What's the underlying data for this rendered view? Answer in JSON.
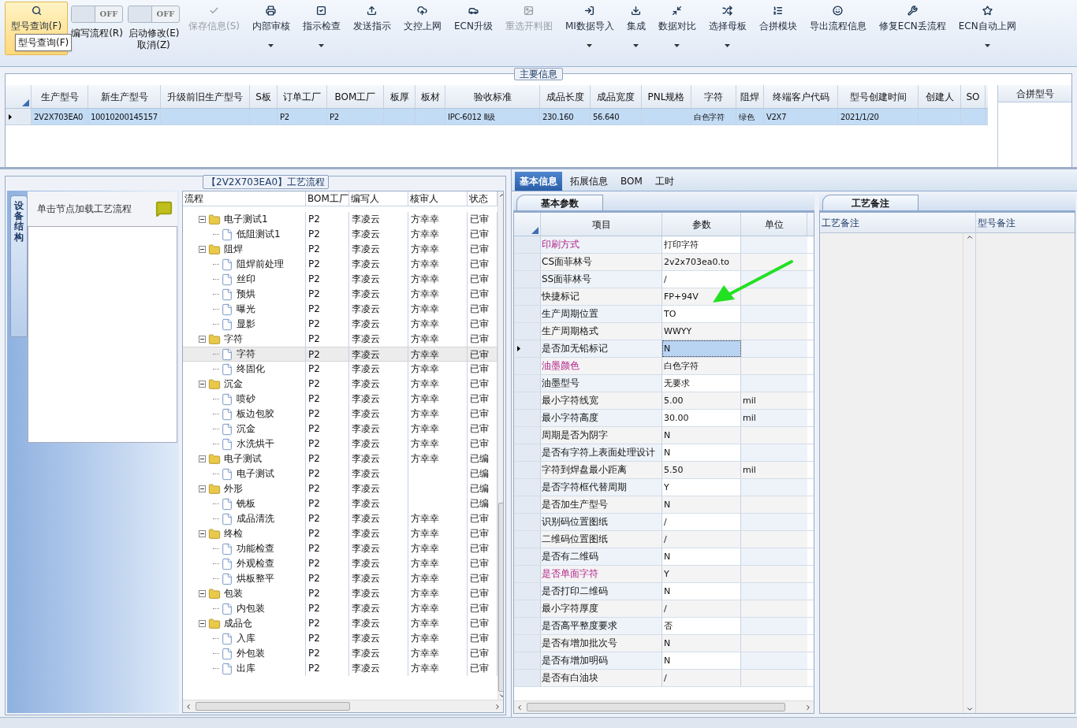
{
  "toolbar": {
    "items": [
      {
        "kind": "button",
        "label": "型号查询(F)",
        "active": true,
        "disabled": false,
        "dropdown": false
      },
      {
        "kind": "toggle",
        "switch": "OFF",
        "label": "编写流程(R)"
      },
      {
        "kind": "toggle",
        "switch": "OFF",
        "label": "启动修改(E)",
        "sublabel": "取消(Z)"
      },
      {
        "kind": "button",
        "label": "保存信息(S)",
        "active": false,
        "disabled": true,
        "dropdown": false
      },
      {
        "kind": "button",
        "label": "内部审核",
        "active": false,
        "disabled": false,
        "dropdown": true
      },
      {
        "kind": "button",
        "label": "指示检查",
        "active": false,
        "disabled": false,
        "dropdown": true
      },
      {
        "kind": "button",
        "label": "发送指示",
        "active": false,
        "disabled": false,
        "dropdown": false
      },
      {
        "kind": "button",
        "label": "文控上网",
        "active": false,
        "disabled": false,
        "dropdown": false
      },
      {
        "kind": "button",
        "label": "ECN升级",
        "active": false,
        "disabled": false,
        "dropdown": false
      },
      {
        "kind": "button",
        "label": "重选开料图",
        "active": false,
        "disabled": true,
        "dropdown": false
      },
      {
        "kind": "button",
        "label": "MI数据导入",
        "active": false,
        "disabled": false,
        "dropdown": true
      },
      {
        "kind": "button",
        "label": "集成",
        "active": false,
        "disabled": false,
        "dropdown": true
      },
      {
        "kind": "button",
        "label": "数据对比",
        "active": false,
        "disabled": false,
        "dropdown": true
      },
      {
        "kind": "button",
        "label": "选择母板",
        "active": false,
        "disabled": false,
        "dropdown": true
      },
      {
        "kind": "button",
        "label": "合拼模块",
        "active": false,
        "disabled": false,
        "dropdown": false
      },
      {
        "kind": "button",
        "label": "导出流程信息",
        "active": false,
        "disabled": false,
        "dropdown": false
      },
      {
        "kind": "button",
        "label": "修复ECN丢流程",
        "active": false,
        "disabled": false,
        "dropdown": false
      },
      {
        "kind": "button",
        "label": "ECN自动上网",
        "active": false,
        "disabled": false,
        "dropdown": true
      }
    ],
    "tooltip": "型号查询(F)"
  },
  "main_info": {
    "title": "主要信息",
    "columns": [
      "生产型号",
      "新生产型号",
      "升级前旧生产型号",
      "S板",
      "订单工厂",
      "BOM工厂",
      "板厚",
      "板材",
      "验收标准",
      "成品长度",
      "成品宽度",
      "PNL规格",
      "字符",
      "阻焊",
      "终端客户代码",
      "型号创建时间",
      "创建人",
      "SO"
    ],
    "rows": [
      {
        "selected": true,
        "cells": [
          "2V2X703EA0",
          "10010200145157",
          null,
          null,
          "P2",
          "P2",
          null,
          null,
          "IPC-6012 Ⅱ级",
          "230.160",
          "56.640",
          null,
          "白色字符",
          "绿色",
          "V2X7",
          "2021/1/20",
          null,
          null
        ]
      }
    ],
    "side_column": "合拼型号"
  },
  "side_tab": "设备结构",
  "node_hint": "单击节点加载工艺流程",
  "process": {
    "title": "【2V2X703EA0】工艺流程",
    "columns": [
      "流程",
      "BOM工厂",
      "编写人",
      "核审人",
      "状态"
    ],
    "rows": [
      {
        "name": "电子测试1",
        "bom": "P2",
        "writer": "李凌云",
        "reviewer": "方幸幸",
        "status": "已审",
        "selected": false,
        "expanded": true,
        "children": [
          {
            "name": "低阻测试1",
            "bom": "P2",
            "writer": "李凌云",
            "reviewer": "方幸幸",
            "status": "已审",
            "selected": false
          }
        ]
      },
      {
        "name": "阻焊",
        "bom": "P2",
        "writer": "李凌云",
        "reviewer": "方幸幸",
        "status": "已审",
        "selected": false,
        "expanded": true,
        "children": [
          {
            "name": "阻焊前处理",
            "bom": "P2",
            "writer": "李凌云",
            "reviewer": "方幸幸",
            "status": "已审",
            "selected": false
          },
          {
            "name": "丝印",
            "bom": "P2",
            "writer": "李凌云",
            "reviewer": "方幸幸",
            "status": "已审",
            "selected": false
          },
          {
            "name": "预烘",
            "bom": "P2",
            "writer": "李凌云",
            "reviewer": "方幸幸",
            "status": "已审",
            "selected": false
          },
          {
            "name": "曝光",
            "bom": "P2",
            "writer": "李凌云",
            "reviewer": "方幸幸",
            "status": "已审",
            "selected": false
          },
          {
            "name": "显影",
            "bom": "P2",
            "writer": "李凌云",
            "reviewer": "方幸幸",
            "status": "已审",
            "selected": false
          }
        ]
      },
      {
        "name": "字符",
        "bom": "P2",
        "writer": "李凌云",
        "reviewer": "方幸幸",
        "status": "已审",
        "selected": false,
        "expanded": true,
        "children": [
          {
            "name": "字符",
            "bom": "P2",
            "writer": "李凌云",
            "reviewer": "方幸幸",
            "status": "已审",
            "selected": true
          },
          {
            "name": "终固化",
            "bom": "P2",
            "writer": "李凌云",
            "reviewer": "方幸幸",
            "status": "已审",
            "selected": false
          }
        ]
      },
      {
        "name": "沉金",
        "bom": "P2",
        "writer": "李凌云",
        "reviewer": "方幸幸",
        "status": "已审",
        "selected": false,
        "expanded": true,
        "children": [
          {
            "name": "喷砂",
            "bom": "P2",
            "writer": "李凌云",
            "reviewer": "方幸幸",
            "status": "已审",
            "selected": false
          },
          {
            "name": "板边包胶",
            "bom": "P2",
            "writer": "李凌云",
            "reviewer": "方幸幸",
            "status": "已审",
            "selected": false
          },
          {
            "name": "沉金",
            "bom": "P2",
            "writer": "李凌云",
            "reviewer": "方幸幸",
            "status": "已审",
            "selected": false
          },
          {
            "name": "水洗烘干",
            "bom": "P2",
            "writer": "李凌云",
            "reviewer": "方幸幸",
            "status": "已审",
            "selected": false
          }
        ]
      },
      {
        "name": "电子测试",
        "bom": "P2",
        "writer": "李凌云",
        "reviewer": "方幸幸",
        "status": "已编",
        "selected": false,
        "expanded": true,
        "children": [
          {
            "name": "电子测试",
            "bom": "P2",
            "writer": "李凌云",
            "status": "已编",
            "selected": false
          }
        ]
      },
      {
        "name": "外形",
        "bom": "P2",
        "writer": "李凌云",
        "status": "已编",
        "selected": false,
        "expanded": true,
        "children": [
          {
            "name": "铣板",
            "bom": "P2",
            "writer": "李凌云",
            "status": "已编",
            "selected": false
          },
          {
            "name": "成品清洗",
            "bom": "P2",
            "writer": "李凌云",
            "reviewer": "方幸幸",
            "status": "已审",
            "selected": false
          }
        ]
      },
      {
        "name": "终检",
        "bom": "P2",
        "writer": "李凌云",
        "reviewer": "方幸幸",
        "status": "已审",
        "selected": false,
        "expanded": true,
        "children": [
          {
            "name": "功能检查",
            "bom": "P2",
            "writer": "李凌云",
            "reviewer": "方幸幸",
            "status": "已审",
            "selected": false
          },
          {
            "name": "外观检查",
            "bom": "P2",
            "writer": "李凌云",
            "reviewer": "方幸幸",
            "status": "已审",
            "selected": false
          },
          {
            "name": "烘板整平",
            "bom": "P2",
            "writer": "李凌云",
            "reviewer": "方幸幸",
            "status": "已审",
            "selected": false
          }
        ]
      },
      {
        "name": "包装",
        "bom": "P2",
        "writer": "李凌云",
        "reviewer": "方幸幸",
        "status": "已审",
        "selected": false,
        "expanded": true,
        "children": [
          {
            "name": "内包装",
            "bom": "P2",
            "writer": "李凌云",
            "reviewer": "方幸幸",
            "status": "已审",
            "selected": false
          }
        ]
      },
      {
        "name": "成品仓",
        "bom": "P2",
        "writer": "李凌云",
        "reviewer": "方幸幸",
        "status": "已审",
        "selected": false,
        "expanded": true,
        "children": [
          {
            "name": "入库",
            "bom": "P2",
            "writer": "李凌云",
            "reviewer": "方幸幸",
            "status": "已审",
            "selected": false
          },
          {
            "name": "外包装",
            "bom": "P2",
            "writer": "李凌云",
            "reviewer": "方幸幸",
            "status": "已审",
            "selected": false
          },
          {
            "name": "出库",
            "bom": "P2",
            "writer": "李凌云",
            "reviewer": "方幸幸",
            "status": "已审",
            "selected": false
          }
        ]
      }
    ]
  },
  "detail_tabs": [
    {
      "label": "基本信息",
      "selected": true
    },
    {
      "label": "拓展信息",
      "selected": false
    },
    {
      "label": "BOM",
      "selected": false
    },
    {
      "label": "工时",
      "selected": false
    }
  ],
  "params": {
    "tab": "基本参数",
    "columns": [
      "项目",
      "参数",
      "单位"
    ],
    "rows": [
      {
        "label": "印刷方式",
        "value": "打印字符",
        "highlight": true,
        "selected": false
      },
      {
        "label": "CS面菲林号",
        "value": "2v2x703ea0.to",
        "highlight": false,
        "selected": false
      },
      {
        "label": "SS面菲林号",
        "value": "/",
        "highlight": false,
        "selected": false
      },
      {
        "label": "快捷标记",
        "value": "FP+94V",
        "highlight": false,
        "selected": false
      },
      {
        "label": "生产周期位置",
        "value": "TO",
        "highlight": false,
        "selected": false
      },
      {
        "label": "生产周期格式",
        "value": "WWYY",
        "highlight": false,
        "selected": false
      },
      {
        "label": "是否加无铅标记",
        "value": "N",
        "highlight": false,
        "selected": true
      },
      {
        "label": "油墨颜色",
        "value": "白色字符",
        "highlight": true,
        "selected": false
      },
      {
        "label": "油墨型号",
        "value": "无要求",
        "highlight": false,
        "selected": false
      },
      {
        "label": "最小字符线宽",
        "value": "5.00",
        "unit": "mil",
        "highlight": false,
        "selected": false
      },
      {
        "label": "最小字符高度",
        "value": "30.00",
        "unit": "mil",
        "highlight": false,
        "selected": false
      },
      {
        "label": "周期是否为阴字",
        "value": "N",
        "highlight": false,
        "selected": false
      },
      {
        "label": "是否有字符上表面处理设计",
        "value": "N",
        "highlight": false,
        "selected": false
      },
      {
        "label": "字符到焊盘最小距离",
        "value": "5.50",
        "unit": "mil",
        "highlight": false,
        "selected": false
      },
      {
        "label": "是否字符框代替周期",
        "value": "Y",
        "highlight": false,
        "selected": false
      },
      {
        "label": "是否加生产型号",
        "value": "N",
        "highlight": false,
        "selected": false
      },
      {
        "label": "识别码位置图纸",
        "value": "/",
        "highlight": false,
        "selected": false
      },
      {
        "label": "二维码位置图纸",
        "value": "/",
        "highlight": false,
        "selected": false
      },
      {
        "label": "是否有二维码",
        "value": "N",
        "highlight": false,
        "selected": false
      },
      {
        "label": "是否单面字符",
        "value": "Y",
        "highlight": true,
        "selected": false
      },
      {
        "label": "是否打印二维码",
        "value": "N",
        "highlight": false,
        "selected": false
      },
      {
        "label": "最小字符厚度",
        "value": "/",
        "highlight": false,
        "selected": false
      },
      {
        "label": "是否高平整度要求",
        "value": "否",
        "highlight": false,
        "selected": false
      },
      {
        "label": "是否有增加批次号",
        "value": "N",
        "highlight": false,
        "selected": false
      },
      {
        "label": "是否有增加明码",
        "value": "N",
        "highlight": false,
        "selected": false
      },
      {
        "label": "是否有白油块",
        "value": "/",
        "highlight": false,
        "selected": false
      }
    ]
  },
  "notes": {
    "tab": "工艺备注",
    "columns": [
      "工艺备注",
      "型号备注"
    ]
  }
}
